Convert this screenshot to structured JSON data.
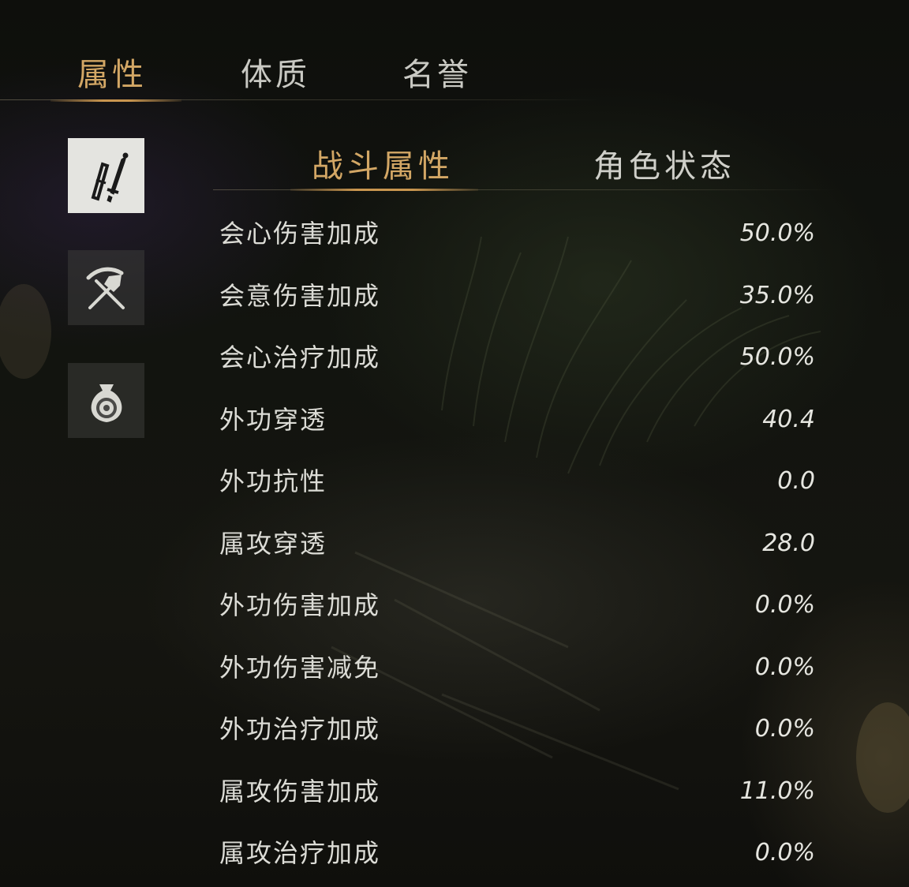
{
  "top_tabs": [
    {
      "label": "属性",
      "active": true
    },
    {
      "label": "体质",
      "active": false
    },
    {
      "label": "名誉",
      "active": false
    }
  ],
  "side_icons": [
    {
      "icon": "weapon-icon",
      "active": true
    },
    {
      "icon": "tools-icon",
      "active": false
    },
    {
      "icon": "money-bag-icon",
      "active": false
    }
  ],
  "sub_tabs": [
    {
      "label": "战斗属性",
      "active": true
    },
    {
      "label": "角色状态",
      "active": false
    }
  ],
  "stats": [
    {
      "label": "会心伤害加成",
      "value": "50.0%"
    },
    {
      "label": "会意伤害加成",
      "value": "35.0%"
    },
    {
      "label": "会心治疗加成",
      "value": "50.0%"
    },
    {
      "label": "外功穿透",
      "value": "40.4"
    },
    {
      "label": "外功抗性",
      "value": "0.0"
    },
    {
      "label": "属攻穿透",
      "value": "28.0"
    },
    {
      "label": "外功伤害加成",
      "value": "0.0%"
    },
    {
      "label": "外功伤害减免",
      "value": "0.0%"
    },
    {
      "label": "外功治疗加成",
      "value": "0.0%"
    },
    {
      "label": "属攻伤害加成",
      "value": "11.0%"
    },
    {
      "label": "属攻治疗加成",
      "value": "0.0%"
    }
  ],
  "colors": {
    "accent": "#d3a765",
    "text": "#dcdcd6",
    "background": "#12140f"
  }
}
